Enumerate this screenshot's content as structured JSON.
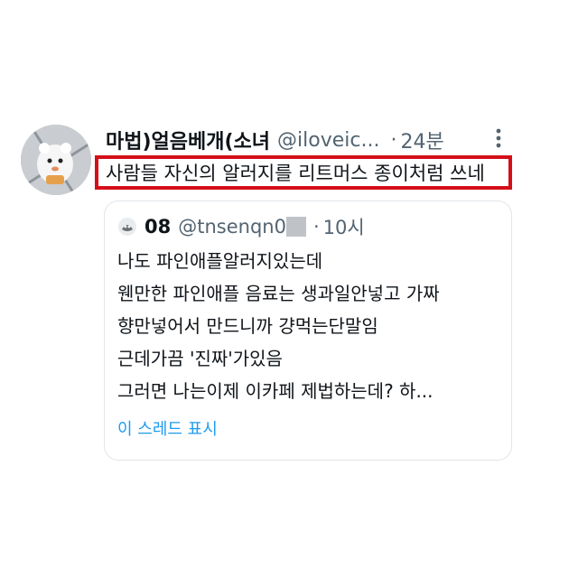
{
  "tweet": {
    "display_name": "마법)얼음베개(소녀",
    "handle": "@iloveic...",
    "dot": "·",
    "time": "24분",
    "more_icon": "more-vertical-icon",
    "text": "사람들 자신의 알러지를 리트머스 종이처럼 쓰네",
    "highlight_color": "#d40f18"
  },
  "quote": {
    "display_name": "08",
    "handle": "@tnsenqn0",
    "dot": "·",
    "time": "10시",
    "lines": [
      "나도 파인애플알러지있는데",
      "웬만한 파인애플 음료는 생과일안넣고 가짜",
      "향만넣어서 만드니까 걍먹는단말임",
      "근데가끔 '진짜'가있음",
      "그러면 나는이제 이카페 제법하는데? 하..."
    ],
    "show_thread": "이 스레드 표시",
    "link_color": "#1d9bf0"
  }
}
